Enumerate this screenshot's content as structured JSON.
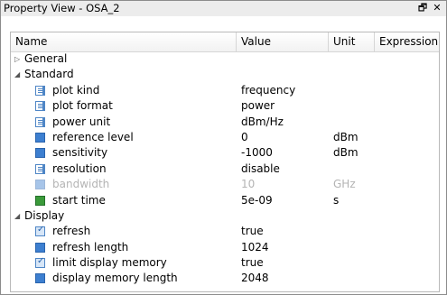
{
  "window": {
    "title": "Property View - OSA_2",
    "restore_glyph": "🗗",
    "close_glyph": "✕"
  },
  "columns": {
    "name": "Name",
    "value": "Value",
    "unit": "Unit",
    "expression": "Expression"
  },
  "groups": {
    "general": {
      "label": "General",
      "expanded": false
    },
    "standard": {
      "label": "Standard",
      "expanded": true
    },
    "display": {
      "label": "Display",
      "expanded": true
    }
  },
  "standard_rows": [
    {
      "name": "plot kind",
      "value": "frequency",
      "unit": "",
      "icon": "combo-list-icon",
      "enabled": true
    },
    {
      "name": "plot format",
      "value": "power",
      "unit": "",
      "icon": "combo-list-icon",
      "enabled": true
    },
    {
      "name": "power unit",
      "value": "dBm/Hz",
      "unit": "",
      "icon": "combo-list-icon",
      "enabled": true
    },
    {
      "name": "reference level",
      "value": "0",
      "unit": "dBm",
      "icon": "numeric-field-icon",
      "enabled": true
    },
    {
      "name": "sensitivity",
      "value": "-1000",
      "unit": "dBm",
      "icon": "numeric-field-icon",
      "enabled": true
    },
    {
      "name": "resolution",
      "value": "disable",
      "unit": "",
      "icon": "combo-list-icon",
      "enabled": true
    },
    {
      "name": "bandwidth",
      "value": "10",
      "unit": "GHz",
      "icon": "numeric-field-icon",
      "enabled": false
    },
    {
      "name": "start time",
      "value": "5e-09",
      "unit": "s",
      "icon": "numeric-field-green-icon",
      "enabled": true,
      "highlighted": true
    }
  ],
  "display_rows": [
    {
      "name": "refresh",
      "value": "true",
      "unit": "",
      "icon": "checkbox-icon",
      "enabled": true
    },
    {
      "name": "refresh length",
      "value": "1024",
      "unit": "",
      "icon": "numeric-field-icon",
      "enabled": true
    },
    {
      "name": "limit display memory",
      "value": "true",
      "unit": "",
      "icon": "checkbox-icon",
      "enabled": true
    },
    {
      "name": "display memory length",
      "value": "2048",
      "unit": "",
      "icon": "numeric-field-icon",
      "enabled": true
    }
  ],
  "colors": {
    "highlight": "#f3f307",
    "icon_blue": "#3d7fd0",
    "icon_green": "#3a9a3a",
    "disabled_text": "#b4b4b4"
  }
}
